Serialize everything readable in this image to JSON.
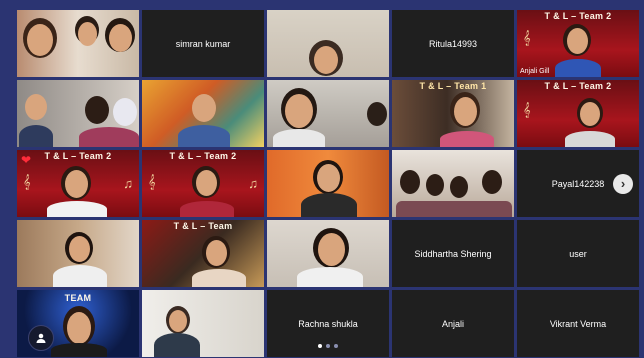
{
  "tiles": [
    {
      "row": 1,
      "col": 1,
      "kind": "video",
      "scene": "kids-selfie"
    },
    {
      "row": 1,
      "col": 2,
      "kind": "name",
      "label": "simran kumar"
    },
    {
      "row": 1,
      "col": 3,
      "kind": "video",
      "scene": "classroom"
    },
    {
      "row": 1,
      "col": 4,
      "kind": "name",
      "label": "Ritula14993"
    },
    {
      "row": 1,
      "col": 5,
      "kind": "video",
      "scene": "tl-team2-bg",
      "banner": "T & L – Team 2",
      "caption": "Anjali Gill"
    },
    {
      "row": 2,
      "col": 1,
      "kind": "video",
      "scene": "masked-family"
    },
    {
      "row": 2,
      "col": 2,
      "kind": "video",
      "scene": "painted-bg"
    },
    {
      "row": 2,
      "col": 3,
      "kind": "video",
      "scene": "girl-glasses"
    },
    {
      "row": 2,
      "col": 4,
      "kind": "video",
      "scene": "tl-team1-bg",
      "banner": "T & L – Team 1"
    },
    {
      "row": 2,
      "col": 5,
      "kind": "video",
      "scene": "tl-team2-bg",
      "banner": "T & L – Team 2"
    },
    {
      "row": 3,
      "col": 1,
      "kind": "video",
      "scene": "tl-team2-bg",
      "banner": "T & L – Team 2",
      "heart": true
    },
    {
      "row": 3,
      "col": 2,
      "kind": "video",
      "scene": "tl-team2-bg",
      "banner": "T & L – Team 2"
    },
    {
      "row": 3,
      "col": 3,
      "kind": "video",
      "scene": "orange-room"
    },
    {
      "row": 3,
      "col": 4,
      "kind": "video",
      "scene": "family-room"
    },
    {
      "row": 3,
      "col": 5,
      "kind": "name",
      "label": "Payal142238",
      "next": true
    },
    {
      "row": 4,
      "col": 1,
      "kind": "video",
      "scene": "man-room"
    },
    {
      "row": 4,
      "col": 2,
      "kind": "video",
      "scene": "tl-team-guitar",
      "banner": "T & L – Team"
    },
    {
      "row": 4,
      "col": 3,
      "kind": "video",
      "scene": "headphones"
    },
    {
      "row": 4,
      "col": 4,
      "kind": "name",
      "label": "Siddhartha Shering"
    },
    {
      "row": 4,
      "col": 5,
      "kind": "name",
      "label": "user"
    },
    {
      "row": 5,
      "col": 1,
      "kind": "video",
      "scene": "team-blue",
      "banner": "TEAM"
    },
    {
      "row": 5,
      "col": 2,
      "kind": "video",
      "scene": "man-office"
    },
    {
      "row": 5,
      "col": 3,
      "kind": "name",
      "label": "Rachna shukla"
    },
    {
      "row": 5,
      "col": 4,
      "kind": "name",
      "label": "Anjali"
    },
    {
      "row": 5,
      "col": 5,
      "kind": "name",
      "label": "Vikrant Verma"
    }
  ],
  "pager": {
    "count": 3,
    "active": 0
  },
  "colors": {
    "background": "#2b3472",
    "tile": "#1f1f1f",
    "banner": "#a8151d"
  }
}
